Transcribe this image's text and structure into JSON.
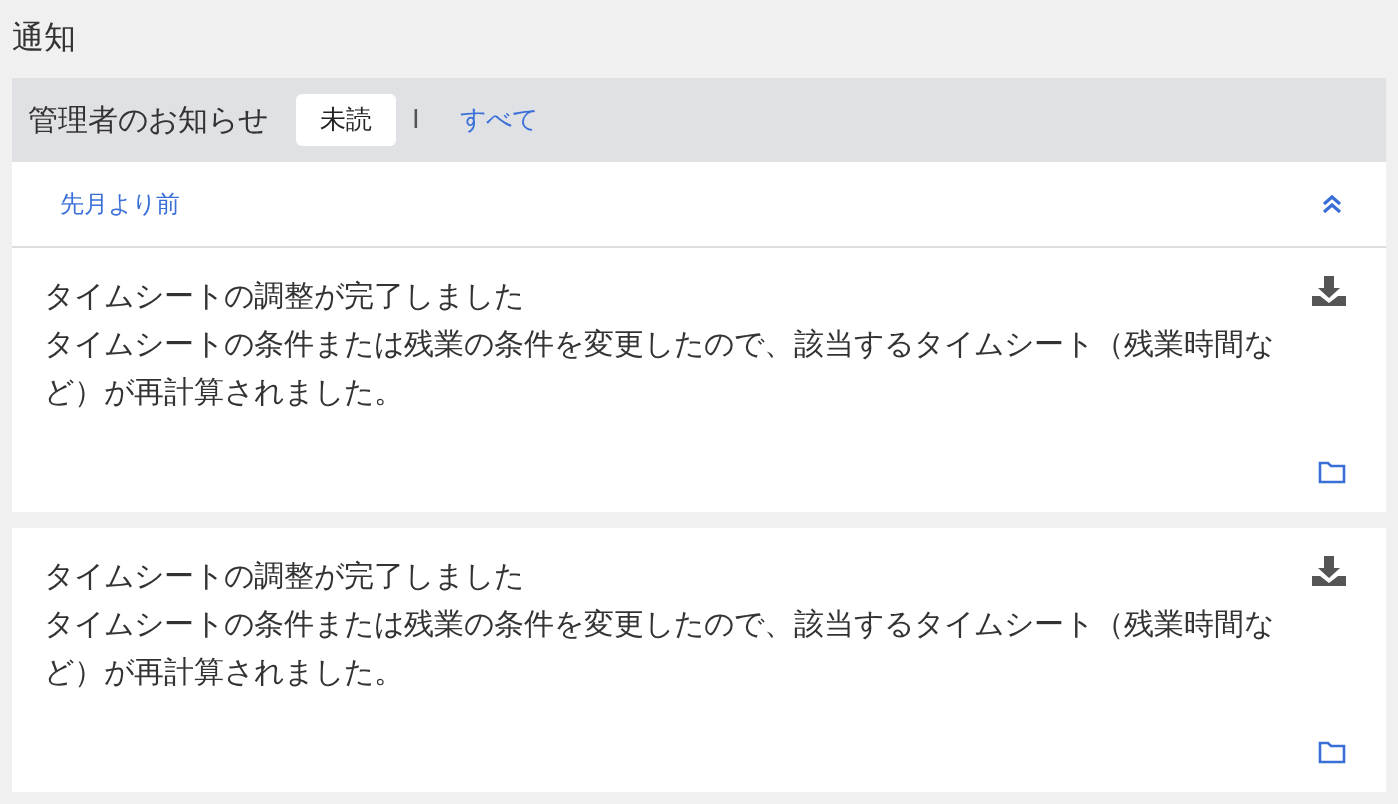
{
  "page_title": "通知",
  "header": {
    "title": "管理者のお知らせ",
    "tabs": [
      {
        "label": "未読",
        "selected": true
      },
      {
        "label": "すべて",
        "selected": false
      }
    ],
    "separator": "I"
  },
  "group": {
    "label": "先月より前",
    "expanded": true
  },
  "notifications": [
    {
      "title": "タイムシートの調整が完了しました",
      "body": "タイムシートの条件または残業の条件を変更したので、該当するタイムシート（残業時間など）が再計算されました。"
    },
    {
      "title": "タイムシートの調整が完了しました",
      "body": "タイムシートの条件または残業の条件を変更したので、該当するタイムシート（残業時間など）が再計算されました。"
    }
  ]
}
